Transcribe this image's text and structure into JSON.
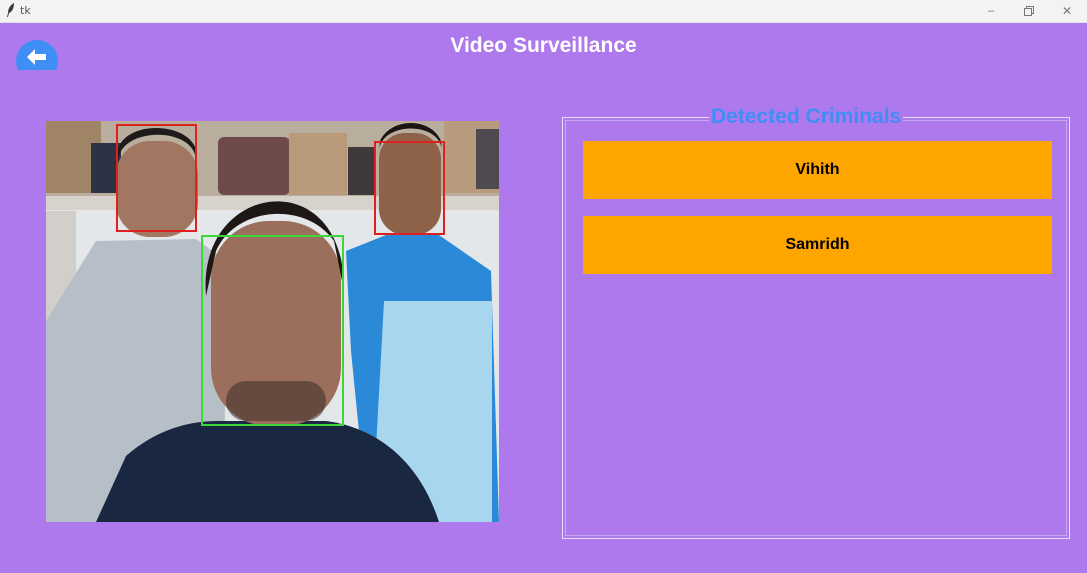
{
  "window": {
    "title": "tk",
    "min_glyph": "–",
    "close_glyph": "✕"
  },
  "header": {
    "title": "Video Surveillance",
    "back_icon": "back-arrow-icon"
  },
  "video": {
    "face_boxes": [
      {
        "label": "unknown-face-left",
        "color": "#e0201f"
      },
      {
        "label": "recognized-face-center",
        "color": "#3cd63a"
      },
      {
        "label": "unknown-face-right",
        "color": "#e0201f"
      }
    ]
  },
  "panel": {
    "legend": "Detected Criminals",
    "criminals": [
      "Vihith",
      "Samridh"
    ]
  },
  "colors": {
    "background": "#ad79ec",
    "button": "#ffa500",
    "legend": "#3f8ef5",
    "back_button": "#3f8ef5"
  }
}
